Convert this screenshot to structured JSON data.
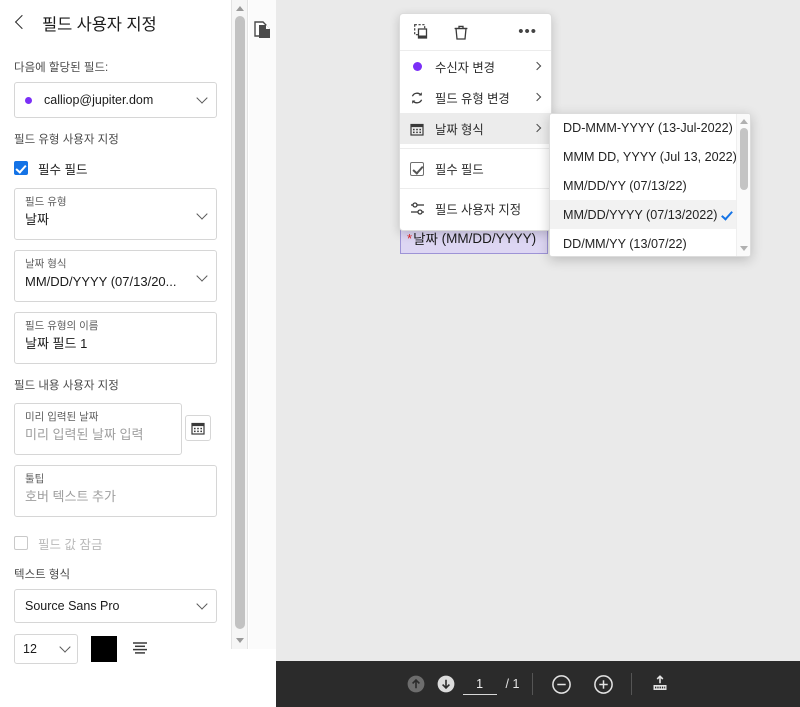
{
  "sidebar": {
    "title": "필드 사용자 지정",
    "back_icon": "back-chevron-icon",
    "assigned_label": "다음에 할당된 필드:",
    "assignee": {
      "email": "calliop@jupiter.dom",
      "dot_color": "#7b2ff7"
    },
    "field_type_section_label": "필드 유형 사용자 지정",
    "required_field_label": "필수 필드",
    "field_type": {
      "caption": "필드 유형",
      "value": "날짜"
    },
    "date_format": {
      "caption": "날짜 형식",
      "value": "MM/DD/YYYY (07/13/20..."
    },
    "field_name": {
      "caption": "필드 유형의 이름",
      "value": "날짜 필드 1"
    },
    "content_section_label": "필드 내용 사용자 지정",
    "prefilled_date": {
      "caption": "미리 입력된 날짜",
      "placeholder": "미리 입력된 날짜 입력",
      "icon": "calendar-icon"
    },
    "tooltip_field": {
      "caption": "툴팁",
      "placeholder": "호버 텍스트 추가"
    },
    "lock_value_label": "필드 값 잠금",
    "text_format_label": "텍스트 형식",
    "font_family": "Source Sans Pro",
    "font_size": "12",
    "font_color": "#000000",
    "align_icon": "align-lines-icon",
    "pages_icon": "pages-copy-icon"
  },
  "context_menu": {
    "tools": {
      "duplicate_icon": "duplicate-icon",
      "delete_icon": "trash-icon",
      "more_icon": "more-ellipsis-icon",
      "more_label": "•••"
    },
    "items": [
      {
        "label": "수신자 변경",
        "icon": "recipient-dot-icon",
        "submenu": true,
        "highlighted": false
      },
      {
        "label": "필드 유형 변경",
        "icon": "refresh-icon",
        "submenu": true,
        "highlighted": false
      },
      {
        "label": "날짜 형식",
        "icon": "calendar-icon",
        "submenu": true,
        "highlighted": true
      },
      {
        "label": "필수 필드",
        "icon": "checkbox-checked-icon",
        "submenu": false,
        "highlighted": false
      },
      {
        "label": "필드 사용자 지정",
        "icon": "sliders-icon",
        "submenu": false,
        "highlighted": false
      }
    ]
  },
  "date_format_dropdown": {
    "options": [
      {
        "label": "DD-MMM-YYYY (13-Jul-2022)",
        "selected": false
      },
      {
        "label": "MMM DD, YYYY (Jul 13, 2022)",
        "selected": false
      },
      {
        "label": "MM/DD/YY (07/13/22)",
        "selected": false
      },
      {
        "label": "MM/DD/YYYY (07/13/2022)",
        "selected": true
      },
      {
        "label": "DD/MM/YY (13/07/22)",
        "selected": false
      }
    ],
    "check_color": "#1473e6"
  },
  "document": {
    "field": {
      "required_marker": "*",
      "label": "날짜",
      "format": "(MM/DD/YYYY)"
    }
  },
  "bottom_toolbar": {
    "prev_page_icon": "arrow-up-circle-icon",
    "next_page_icon": "arrow-down-circle-icon",
    "page_value": "1",
    "page_total": "/ 1",
    "zoom_out_icon": "minus-circle-icon",
    "zoom_in_icon": "plus-circle-icon",
    "fit_icon": "fit-page-icon"
  }
}
